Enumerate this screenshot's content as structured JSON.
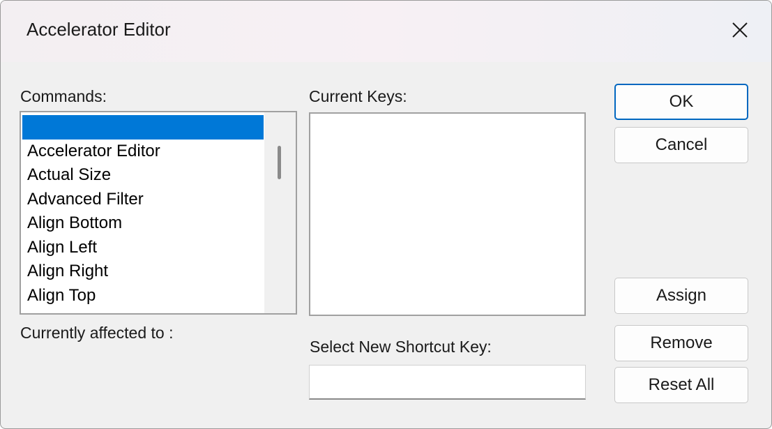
{
  "window": {
    "title": "Accelerator Editor",
    "close_icon": "close-icon"
  },
  "commands": {
    "label": "Commands:",
    "items": [
      "",
      "Accelerator Editor",
      "Actual Size",
      "Advanced Filter",
      "Align Bottom",
      "Align Left",
      "Align Right",
      "Align Top"
    ],
    "selected_index": 0
  },
  "current_keys": {
    "label": "Current Keys:"
  },
  "affected": {
    "label": "Currently affected to :"
  },
  "shortcut": {
    "label": "Select New Shortcut Key:",
    "value": ""
  },
  "buttons": {
    "ok": "OK",
    "cancel": "Cancel",
    "assign": "Assign",
    "remove": "Remove",
    "reset_all": "Reset All"
  },
  "colors": {
    "selection": "#0078d7",
    "default_button_border": "#0067c0"
  }
}
